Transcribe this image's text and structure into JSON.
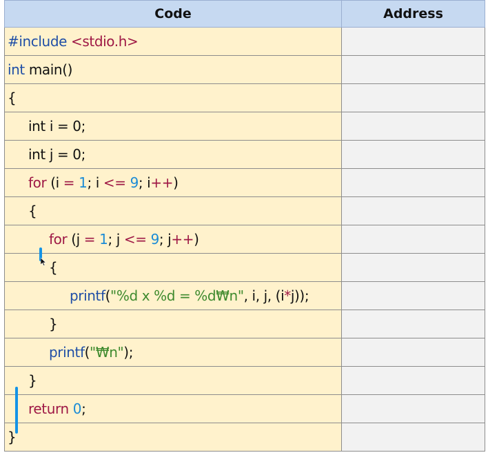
{
  "table": {
    "header_code": "Code",
    "header_address": "Address"
  },
  "lines": {
    "l1": {
      "pre": "#include",
      "sp": " ",
      "hdr": "<stdio.h>"
    },
    "l2": {
      "kw": "int",
      "rest": " main()"
    },
    "l3": {
      "text": "{"
    },
    "l4": {
      "kw": "int",
      "a": " i ",
      "op": "=",
      "b": " 0;"
    },
    "l5": {
      "kw": "int",
      "a": " j ",
      "op": "=",
      "b": " 0;"
    },
    "l6": {
      "kw": "for",
      "a": " (i ",
      "op1": "=",
      "sp1": " ",
      "n1": "1",
      "b": "; i ",
      "op2": "<=",
      "sp2": " ",
      "n2": "9",
      "c": "; i",
      "op3": "++",
      "d": ")"
    },
    "l7": {
      "text": "{"
    },
    "l8": {
      "kw": "for",
      "a": " (j ",
      "op1": "=",
      "sp1": " ",
      "n1": "1",
      "b": "; j ",
      "op2": "<=",
      "sp2": " ",
      "n2": "9",
      "c": "; j",
      "op3": "++",
      "d": ")"
    },
    "l9": {
      "text": "{"
    },
    "l10": {
      "fn": "printf",
      "a": "(",
      "str": "\"%d x %d = %d₩n\"",
      "b": ", i, j, (i",
      "op": "*",
      "c": "j));"
    },
    "l11": {
      "text": "}"
    },
    "l12": {
      "fn": "printf",
      "a": "(",
      "str": "\"₩n\"",
      "b": ");"
    },
    "l13": {
      "text": "}"
    },
    "l14": {
      "kw": "return",
      "sp": " ",
      "num": "0",
      "semi": ";"
    },
    "l15": {
      "text": "}"
    }
  },
  "colors": {
    "header_bg": "#c6d9f1",
    "code_bg": "#fff2cc",
    "address_bg": "#f2f2f2",
    "keyword": "#1f4ea6",
    "operator": "#9e1845",
    "number": "#1a8bd6",
    "string": "#3e8a2e",
    "highlight_mark": "#1493e6"
  },
  "icons": {
    "cursor": "mouse-pointer-icon"
  }
}
